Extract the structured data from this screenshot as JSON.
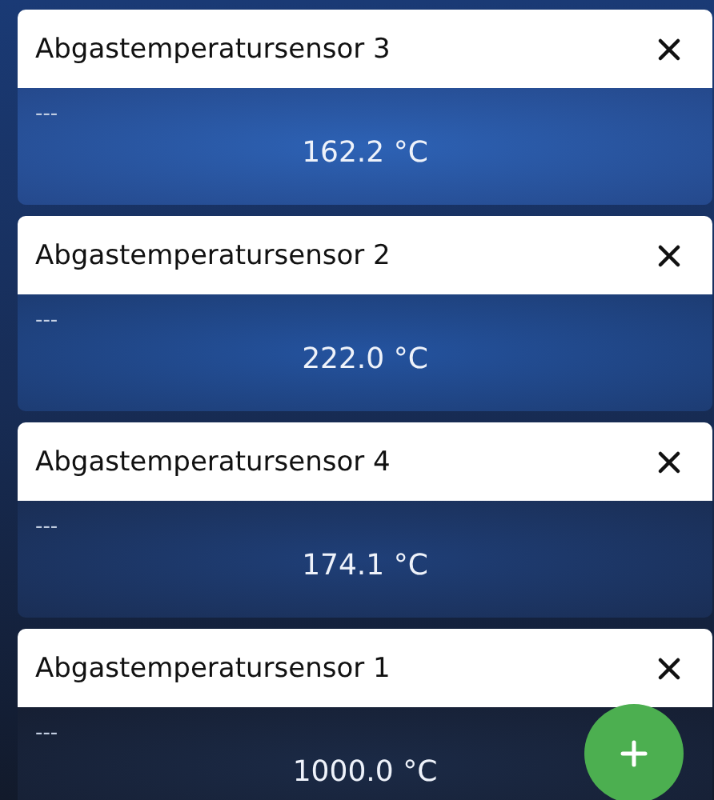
{
  "sensors": [
    {
      "name": "Abgastemperatursensor 3",
      "status": "---",
      "value": "162.2 °C"
    },
    {
      "name": "Abgastemperatursensor 2",
      "status": "---",
      "value": "222.0 °C"
    },
    {
      "name": "Abgastemperatursensor 4",
      "status": "---",
      "value": "174.1 °C"
    },
    {
      "name": "Abgastemperatursensor 1",
      "status": "---",
      "value": "1000.0 °C"
    }
  ]
}
